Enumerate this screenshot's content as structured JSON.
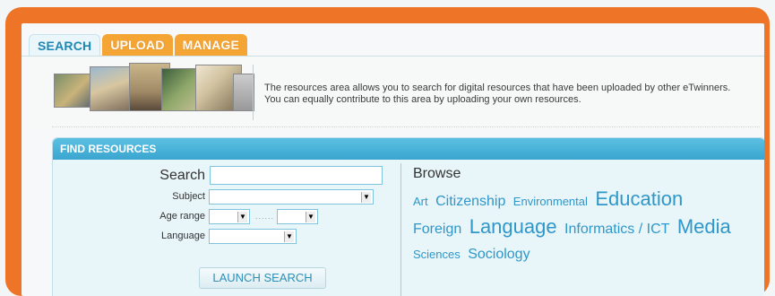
{
  "tabs": [
    {
      "label": "SEARCH",
      "active": true
    },
    {
      "label": "UPLOAD",
      "active": false
    },
    {
      "label": "MANAGE",
      "active": false
    }
  ],
  "intro": {
    "line1": "The resources area allows you to search for digital resources that have been uploaded by other eTwinners.",
    "line2": "You can equally contribute to this area by uploading your own resources."
  },
  "find": {
    "header": "FIND RESOURCES",
    "search_label": "Search",
    "search_value": "",
    "subject_label": "Subject",
    "subject_value": "",
    "age_label": "Age range",
    "age_from": "",
    "age_to": "",
    "age_sep": "......",
    "language_label": "Language",
    "language_value": "",
    "launch_label": "LAUNCH SEARCH"
  },
  "browse": {
    "title": "Browse",
    "tags": [
      {
        "label": "Art",
        "size": 13
      },
      {
        "label": "Citizenship",
        "size": 16
      },
      {
        "label": "Environmental",
        "size": 13
      },
      {
        "label": "Education",
        "size": 22
      },
      {
        "label": "Foreign",
        "size": 16
      },
      {
        "label": "Language",
        "size": 22
      },
      {
        "label": "Informatics / ICT",
        "size": 16
      },
      {
        "label": "Media",
        "size": 22
      },
      {
        "label": "Sciences",
        "size": 13
      },
      {
        "label": "Sociology",
        "size": 16
      }
    ]
  },
  "colors": {
    "frame": "#ee7427",
    "tab_orange": "#f5a533",
    "accent_blue": "#2f97c9",
    "panel_header": "#3aa5d0"
  }
}
